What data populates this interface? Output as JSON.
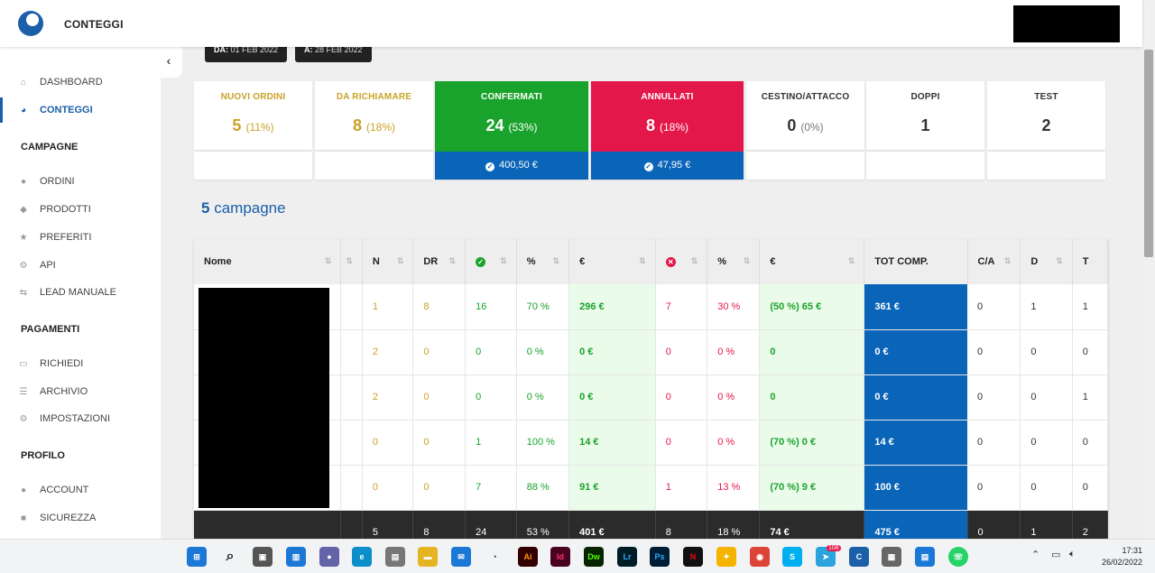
{
  "app": {
    "title": "CONTEGGI"
  },
  "sidebar": {
    "collapse_icon": "chevron-left-icon",
    "items": [
      {
        "label": "DASHBOARD",
        "icon": "home-icon"
      },
      {
        "label": "CONTEGGI",
        "icon": "pie-chart-icon",
        "active": true
      }
    ],
    "sections": [
      {
        "title": "CAMPAGNE",
        "items": [
          {
            "label": "ORDINI",
            "icon": "check-circle-icon"
          },
          {
            "label": "PRODOTTI",
            "icon": "tag-icon"
          },
          {
            "label": "PREFERITI",
            "icon": "star-icon"
          },
          {
            "label": "API",
            "icon": "cogs-icon"
          },
          {
            "label": "LEAD MANUALE",
            "icon": "exchange-icon"
          }
        ]
      },
      {
        "title": "PAGAMENTI",
        "items": [
          {
            "label": "RICHIEDI",
            "icon": "money-icon"
          },
          {
            "label": "ARCHIVIO",
            "icon": "list-icon"
          },
          {
            "label": "IMPOSTAZIONI",
            "icon": "cogs-icon"
          }
        ]
      },
      {
        "title": "PROFILO",
        "items": [
          {
            "label": "ACCOUNT",
            "icon": "user-icon"
          },
          {
            "label": "SICUREZZA",
            "icon": "lock-icon"
          }
        ]
      }
    ]
  },
  "dates": {
    "from_label": "DA:",
    "from_value": "01 FEB 2022",
    "to_label": "A:",
    "to_value": "28 FEB 2022"
  },
  "cards": [
    {
      "label": "NUOVI ORDINI",
      "value": "5",
      "pct": "(11%)"
    },
    {
      "label": "DA RICHIAMARE",
      "value": "8",
      "pct": "(18%)"
    },
    {
      "label": "CONFERMATI",
      "value": "24",
      "pct": "(53%)",
      "amount": "400,50 €"
    },
    {
      "label": "ANNULLATI",
      "value": "8",
      "pct": "(18%)",
      "amount": "47,95 €"
    },
    {
      "label": "CESTINO/ATTACCO",
      "value": "0",
      "pct": "(0%)"
    },
    {
      "label": "DOPPI",
      "value": "1"
    },
    {
      "label": "TEST",
      "value": "2"
    }
  ],
  "campaigns": {
    "count": "5",
    "label": "campagne"
  },
  "table": {
    "headers": [
      "Nome",
      "",
      "N",
      "DR",
      "",
      "%",
      "€",
      "",
      "%",
      "€",
      "TOT COMP.",
      "C/A",
      "D",
      "T"
    ],
    "rows": [
      {
        "n": "1",
        "dr": "8",
        "ok": "16",
        "okp": "70 %",
        "oke": "296 €",
        "ko": "7",
        "kop": "30 %",
        "koe": "(50 %) 65 €",
        "tot": "361 €",
        "ca": "0",
        "d": "1",
        "t": "1"
      },
      {
        "n": "2",
        "dr": "0",
        "ok": "0",
        "okp": "0 %",
        "oke": "0 €",
        "ko": "0",
        "kop": "0 %",
        "koe": "0",
        "tot": "0 €",
        "ca": "0",
        "d": "0",
        "t": "0"
      },
      {
        "n": "2",
        "dr": "0",
        "ok": "0",
        "okp": "0 %",
        "oke": "0 €",
        "ko": "0",
        "kop": "0 %",
        "koe": "0",
        "tot": "0 €",
        "ca": "0",
        "d": "0",
        "t": "1"
      },
      {
        "n": "0",
        "dr": "0",
        "ok": "1",
        "okp": "100 %",
        "oke": "14 €",
        "ko": "0",
        "kop": "0 %",
        "koe": "(70 %) 0 €",
        "tot": "14 €",
        "ca": "0",
        "d": "0",
        "t": "0"
      },
      {
        "n": "0",
        "dr": "0",
        "ok": "7",
        "okp": "88 %",
        "oke": "91 €",
        "ko": "1",
        "kop": "13 %",
        "koe": "(70 %) 9 €",
        "tot": "100 €",
        "ca": "0",
        "d": "0",
        "t": "0"
      }
    ],
    "footer": {
      "n": "5",
      "dr": "8",
      "ok": "24",
      "okp": "53 %",
      "oke": "401 €",
      "ko": "8",
      "kop": "18 %",
      "koe": "74 €",
      "tot": "475 €",
      "ca": "0",
      "d": "1",
      "t": "2"
    }
  },
  "taskbar": {
    "time": "17:31",
    "date": "26/02/2022",
    "badge": "108"
  },
  "colors": {
    "brand": "#1a5fa8",
    "green": "#1aa32c",
    "red": "#e4174a",
    "blue": "#0a64b8",
    "gold": "#c9a227"
  }
}
